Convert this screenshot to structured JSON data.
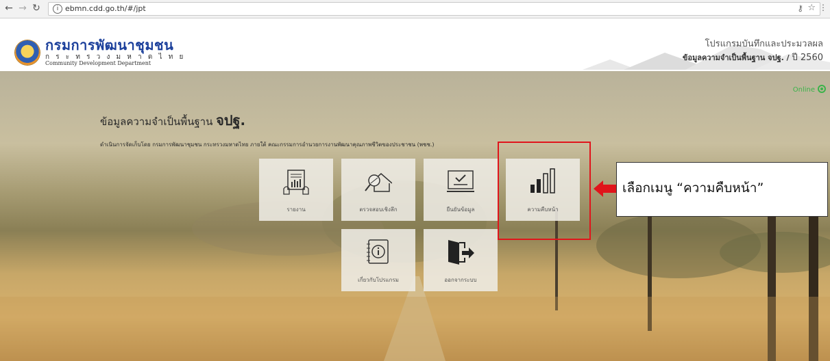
{
  "browser": {
    "url": "ebmn.cdd.go.th/#/jpt",
    "back_icon": "arrow-left-icon",
    "forward_icon": "arrow-right-icon",
    "reload_icon": "reload-icon"
  },
  "header": {
    "org_name_th": "กรมการพัฒนาชุมชน",
    "ministry_th": "ก ร ะ ท ร ว ง ม ห า ด ไ ท ย",
    "org_name_en": "Community Development Department",
    "program_title": "โปรแกรมบันทึกและประมวลผล",
    "program_sub": "ข้อมูลความจำเป็นพื้นฐาน จปฐ. /",
    "program_year": "ปี 2560"
  },
  "status": {
    "label": "Online",
    "color": "#3bb34a"
  },
  "hero": {
    "title": "ข้อมูลความจำเป็นพื้นฐาน",
    "title_bold": "จปฐ.",
    "description": "ดำเนินการจัดเก็บโดย กรมการพัฒนาชุมชน กระทรวงมหาดไทย ภายใต้ คณะกรรมการอำนวยการงานพัฒนาคุณภาพชีวิตของประชาชน (พชช.)"
  },
  "menu": [
    {
      "label": "รายงาน",
      "icon": "report-icon"
    },
    {
      "label": "ตรวจสอบเชิงลึก",
      "icon": "inspect-house-icon"
    },
    {
      "label": "ยืนยันข้อมูล",
      "icon": "confirm-screen-icon"
    },
    {
      "label": "ความคืบหน้า",
      "icon": "progress-bars-icon"
    },
    {
      "label": "เกี่ยวกับโปรแกรม",
      "icon": "info-notebook-icon"
    },
    {
      "label": "ออกจากระบบ",
      "icon": "logout-door-icon"
    }
  ],
  "annotation": {
    "text": "เลือกเมนู “ความคืบหน้า”",
    "color": "#e0141b"
  }
}
